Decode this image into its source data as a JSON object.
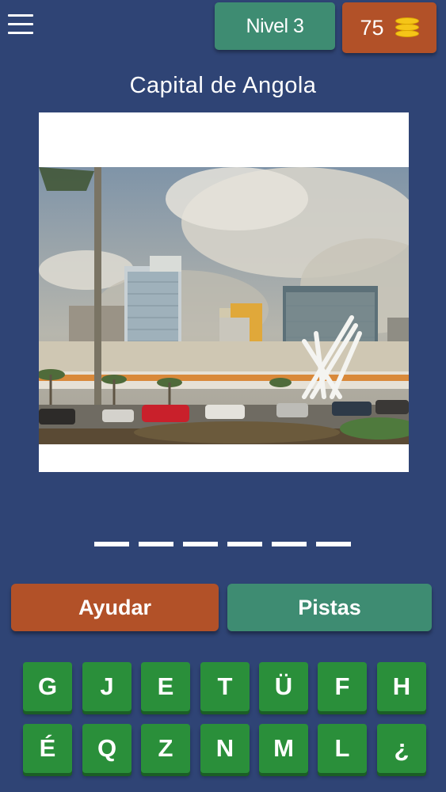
{
  "header": {
    "menu_icon": "hamburger-menu-icon",
    "level_label": "Nivel 3",
    "coins": "75",
    "coin_icon": "coins-stack-icon"
  },
  "question": {
    "title": "Capital de Angola",
    "image_alt": "Luanda cityscape"
  },
  "answer": {
    "slot_count": 6
  },
  "actions": {
    "help_label": "Ayudar",
    "hints_label": "Pistas"
  },
  "keyboard": {
    "rows": [
      [
        "G",
        "J",
        "E",
        "T",
        "Ü",
        "F",
        "H"
      ],
      [
        "É",
        "Q",
        "Z",
        "N",
        "M",
        "L",
        "¿"
      ]
    ]
  },
  "colors": {
    "background": "#2f4475",
    "green_button": "#3e8c72",
    "orange_button": "#b25128",
    "key_green": "#2a8f3a"
  }
}
